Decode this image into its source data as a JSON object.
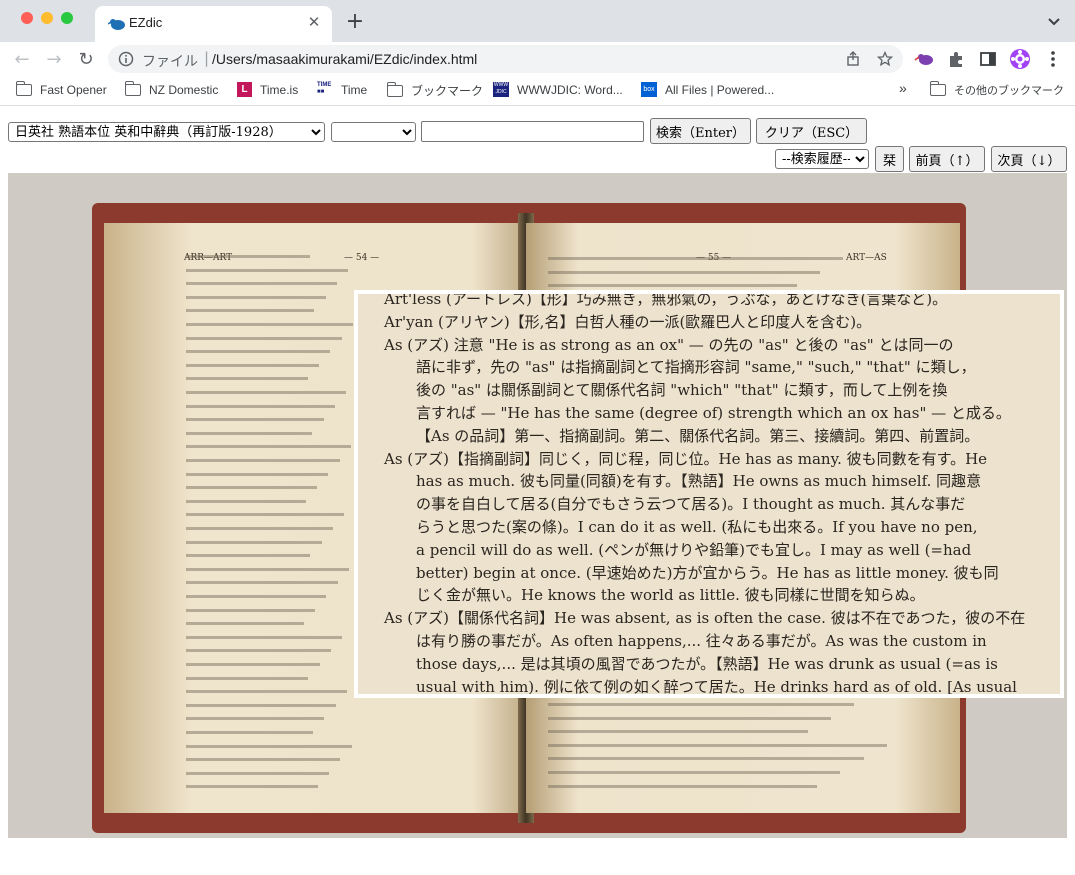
{
  "browser": {
    "tab_title": "EZdic",
    "omnibox_scheme_label": "ファイル",
    "omnibox_url": "/Users/masaakimurakami/EZdic/index.html",
    "bookmarks": [
      {
        "label": "Fast Opener",
        "icon": "folder-icon"
      },
      {
        "label": "NZ Domestic",
        "icon": "folder-icon"
      },
      {
        "label": "Time.is",
        "icon": "timeis-icon"
      },
      {
        "label": "Time",
        "icon": "time-icon"
      },
      {
        "label": "ブックマーク",
        "icon": "folder-icon"
      },
      {
        "label": "WWWJDIC: Word...",
        "icon": "wwwjdic-icon"
      },
      {
        "label": "All Files | Powered...",
        "icon": "box-icon"
      }
    ],
    "bookmarks_overflow": "»",
    "other_bookmarks": "その他のブックマーク"
  },
  "app": {
    "dictionary_select": "日英社 熟語本位 英和中辭典（再訂版-1928）",
    "second_select": "",
    "search_input": "",
    "search_button": "検索（Enter）",
    "clear_button": "クリア（ESC）",
    "history_select": "--検索履歴--",
    "bookmark_button": "栞",
    "prev_button": "前頁（↑）",
    "next_button": "次頁（↓）"
  },
  "scan": {
    "left_header": "ARR—ART",
    "left_page_no": "— 54 —",
    "right_page_no": "— 55 —",
    "right_header": "ART—AS",
    "zoom_lines": [
      "Art'less (アートレス)【形】巧み無き，無邪氣の，うぶな，あどけなき(言葉など)。",
      "Ar'yan (アリヤン)【形,名】白哲人種の一派(歐羅巴人と印度人を含む)。",
      "As (アズ) 注意 \"He is as strong as an ox\" — の先の \"as\" と後の \"as\" とは同一の",
      "語に非ず，先の \"as\" は指摘副詞とて指摘形容詞 \"same,\" \"such,\" \"that\" に類し，",
      "後の \"as\" は關係副詞とて關係代名詞 \"which\" \"that\" に類す，而して上例を換",
      "言すれば — \"He has the same (degree of) strength which an ox has\" — と成る。",
      "【As の品詞】第一、指摘副詞。第二、關係代名詞。第三、接續詞。第四、前置詞。",
      "As (アズ)【指摘副詞】同じく，同じ程，同じ位。He has as many. 彼も同數を有す。He",
      "has as much. 彼も同量(同額)を有す。【熟語】He owns as much himself. 同趣意",
      "の事を自白して居る(自分でもさう云つて居る)。I thought as much. 其んな事だ",
      "らうと思つた(案の條)。I can do it as well. (私にも出來る。If you have no pen,",
      "a pencil will do as well. (ペンが無けりや鉛筆)でも宜し。I may as well (=had",
      "better) begin at once. (早速始めた)方が宜からう。He has as little money. 彼も同",
      "じく金が無い。He knows the world as little. 彼も同樣に世間を知らぬ。",
      "As (アズ)【關係代名詞】He was absent, as is often the case. 彼は不在であつた，彼の不在",
      "は有り勝の事だが。As often happens,... 往々ある事だが。As was the custom in",
      "those days,... 是は其頃の風習であつたが。【熟語】He was drunk as usual (=as is",
      "usual with him). 例に依て例の如く醉つて居た。He drinks hard as of old. [As usual"
    ]
  }
}
